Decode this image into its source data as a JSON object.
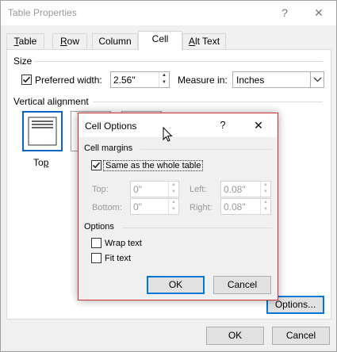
{
  "window": {
    "title": "Table Properties",
    "help_label": "?",
    "close_label": "✕"
  },
  "tabs": [
    {
      "label": "Table",
      "key": "T",
      "rest": "able"
    },
    {
      "label": "Row",
      "key": "R",
      "rest": "ow"
    },
    {
      "label": "Column",
      "key": "U",
      "pre": "Col",
      "rest": "mn"
    },
    {
      "label": "Cell",
      "key": "E",
      "pre": "C",
      "rest": "ll"
    },
    {
      "label": "Alt Text",
      "key": "A",
      "rest": "lt Text"
    }
  ],
  "active_tab": "Cell",
  "size": {
    "section_label": "Size",
    "preferred_width_label": "Preferred width:",
    "preferred_width_checked": true,
    "preferred_width_value": "2.56\"",
    "measure_in_label": "Measure in:",
    "measure_in_value": "Inches"
  },
  "vertical_alignment": {
    "section_label": "Vertical alignment",
    "options": [
      {
        "label": "Top",
        "selected": true
      }
    ]
  },
  "options_button": "Options...",
  "footer": {
    "ok": "OK",
    "cancel": "Cancel"
  },
  "cell_options": {
    "title": "Cell Options",
    "help_label": "?",
    "close_label": "✕",
    "cell_margins_label": "Cell margins",
    "same_as_table_label": "Same as the whole table",
    "same_as_table_checked": true,
    "margins": {
      "top_label": "Top:",
      "top_value": "0\"",
      "left_label": "Left:",
      "left_value": "0.08\"",
      "bottom_label": "Bottom:",
      "bottom_value": "0\"",
      "right_label": "Right:",
      "right_value": "0.08\""
    },
    "options_label": "Options",
    "wrap_text_label": "Wrap text",
    "wrap_text_checked": false,
    "fit_text_label": "Fit text",
    "fit_text_checked": false,
    "ok": "OK",
    "cancel": "Cancel"
  },
  "colors": {
    "accent": "#0078d7",
    "dialog_border": "#c83232"
  }
}
